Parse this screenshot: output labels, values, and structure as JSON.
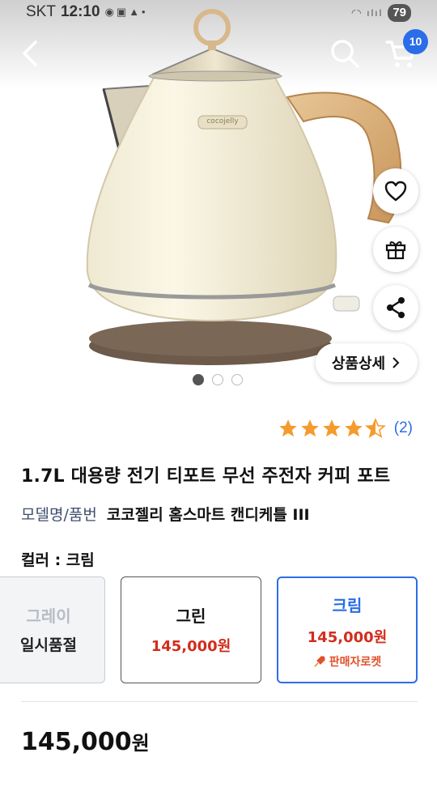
{
  "status_bar": {
    "carrier": "SKT",
    "time": "12:10",
    "battery": "79"
  },
  "header": {
    "cart_count": "10"
  },
  "gallery": {
    "total_images": 3,
    "active_index": 0,
    "detail_button_label": "상품상세"
  },
  "product": {
    "rating": 4.5,
    "review_count": "(2)",
    "title": "1.7L 대용량 전기 티포트 무선 주전자 커피 포트",
    "model_label": "모델명/품번",
    "model_value": "코코젤리 홈스마트 캔디케틀 III",
    "brand_on_kettle": "cocojelly",
    "color_label": "컬러 : 크림",
    "options": [
      {
        "name": "그레이",
        "status": "일시품절"
      },
      {
        "name": "그린",
        "price": "145,000원"
      },
      {
        "name": "크림",
        "price": "145,000원",
        "tag": "판매자로켓"
      }
    ],
    "price_number": "145,000",
    "price_unit": "원"
  },
  "colors": {
    "accent": "#2b6de8",
    "price_red": "#d22d1d",
    "rocket_orange": "#e0512a",
    "star": "#f59b2d"
  }
}
